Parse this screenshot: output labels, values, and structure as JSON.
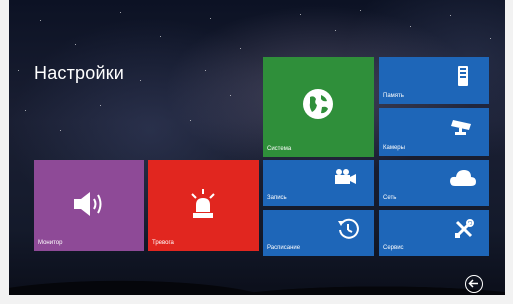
{
  "page": {
    "title": "Настройки"
  },
  "tiles": {
    "intercom": {
      "label": "Монитор",
      "icon": "speaker-icon",
      "color": "#8e4a97"
    },
    "alarm": {
      "label": "Тревога",
      "icon": "alarm-siren-icon",
      "color": "#e1261f"
    },
    "system": {
      "label": "Система",
      "icon": "globe-icon",
      "color": "#2f8f3a"
    },
    "memory": {
      "label": "Память",
      "icon": "memory-card-icon",
      "color": "#1e66b8"
    },
    "cameras": {
      "label": "Камеры",
      "icon": "cctv-camera-icon",
      "color": "#1e66b8"
    },
    "record": {
      "label": "Запись",
      "icon": "video-camera-icon",
      "color": "#1e66b8"
    },
    "network": {
      "label": "Сеть",
      "icon": "cloud-icon",
      "color": "#1e66b8"
    },
    "schedule": {
      "label": "Расписание",
      "icon": "clock-icon",
      "color": "#1e66b8"
    },
    "service": {
      "label": "Сервис",
      "icon": "tools-icon",
      "color": "#1e66b8"
    }
  },
  "nav": {
    "back_icon": "back-arrow-icon"
  }
}
